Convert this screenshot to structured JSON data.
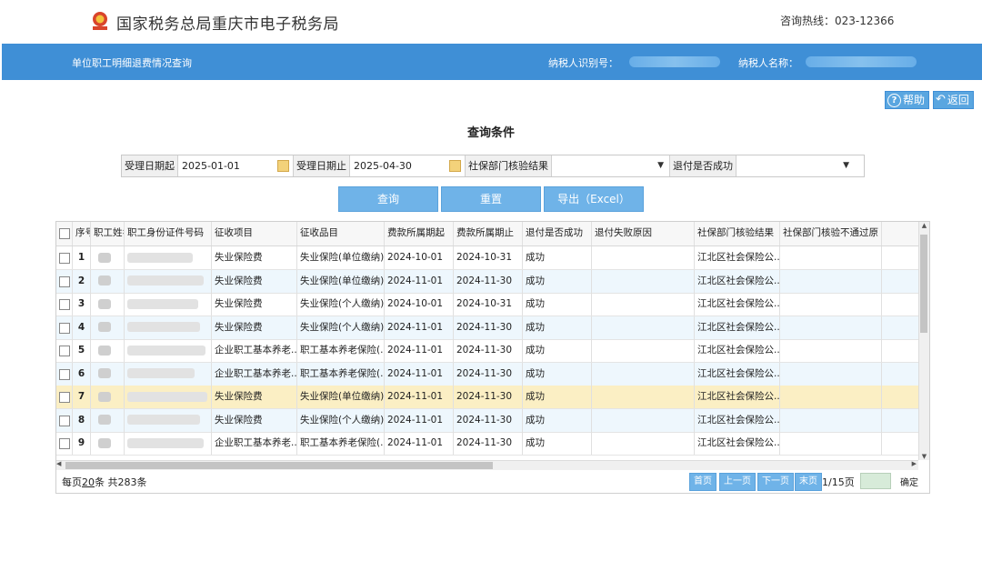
{
  "header": {
    "site_title": "国家税务总局重庆市电子税务局",
    "hotline": "咨询热线：023-12366",
    "emblem_icon": "tax-emblem-icon"
  },
  "banner": {
    "page_name": "单位职工明细退费情况查询",
    "taxpayer_id_label": "纳税人识别号：",
    "taxpayer_name_label": "纳税人名称："
  },
  "toolbar": {
    "help_label": "帮助",
    "back_label": "返回"
  },
  "query": {
    "title": "查询条件",
    "start_label": "受理日期起",
    "start_value": "2025-01-01",
    "end_label": "受理日期止",
    "end_value": "2025-04-30",
    "check_label": "社保部门核验结果",
    "check_value": "",
    "success_label": "退付是否成功",
    "success_value": "",
    "search_btn": "查询",
    "reset_btn": "重置",
    "export_btn": "导出（Excel）"
  },
  "table": {
    "columns": [
      "序号",
      "职工姓名",
      "职工身份证件号码",
      "征收项目",
      "征收品目",
      "费款所属期起",
      "费款所属期止",
      "退付是否成功",
      "退付失败原因",
      "社保部门核验结果",
      "社保部门核验不通过原"
    ],
    "rows": [
      {
        "no": "1",
        "item": "失业保险费",
        "sub": "失业保险(单位缴纳)",
        "start": "2024-10-01",
        "end": "2024-10-31",
        "ok": "成功",
        "reason": "",
        "check": "江北区社会保险公..."
      },
      {
        "no": "2",
        "item": "失业保险费",
        "sub": "失业保险(单位缴纳)",
        "start": "2024-11-01",
        "end": "2024-11-30",
        "ok": "成功",
        "reason": "",
        "check": "江北区社会保险公..."
      },
      {
        "no": "3",
        "item": "失业保险费",
        "sub": "失业保险(个人缴纳)",
        "start": "2024-10-01",
        "end": "2024-10-31",
        "ok": "成功",
        "reason": "",
        "check": "江北区社会保险公..."
      },
      {
        "no": "4",
        "item": "失业保险费",
        "sub": "失业保险(个人缴纳)",
        "start": "2024-11-01",
        "end": "2024-11-30",
        "ok": "成功",
        "reason": "",
        "check": "江北区社会保险公..."
      },
      {
        "no": "5",
        "item": "企业职工基本养老...",
        "sub": "职工基本养老保险(...",
        "start": "2024-11-01",
        "end": "2024-11-30",
        "ok": "成功",
        "reason": "",
        "check": "江北区社会保险公..."
      },
      {
        "no": "6",
        "item": "企业职工基本养老...",
        "sub": "职工基本养老保险(...",
        "start": "2024-11-01",
        "end": "2024-11-30",
        "ok": "成功",
        "reason": "",
        "check": "江北区社会保险公..."
      },
      {
        "no": "7",
        "item": "失业保险费",
        "sub": "失业保险(单位缴纳)",
        "start": "2024-11-01",
        "end": "2024-11-30",
        "ok": "成功",
        "reason": "",
        "check": "江北区社会保险公..."
      },
      {
        "no": "8",
        "item": "失业保险费",
        "sub": "失业保险(个人缴纳)",
        "start": "2024-11-01",
        "end": "2024-11-30",
        "ok": "成功",
        "reason": "",
        "check": "江北区社会保险公..."
      },
      {
        "no": "9",
        "item": "企业职工基本养老...",
        "sub": "职工基本养老保险(...",
        "start": "2024-11-01",
        "end": "2024-11-30",
        "ok": "成功",
        "reason": "",
        "check": "江北区社会保险公..."
      }
    ]
  },
  "pager": {
    "per_page_prefix": "每页",
    "per_page": "20",
    "per_page_suffix": "条 共283条",
    "first": "首页",
    "prev": "上一页",
    "next": "下一页",
    "last": "末页",
    "page_info": "1/15页",
    "confirm": "确定"
  },
  "colors": {
    "accent": "#3f8fd6",
    "selected_row": "#fbefc4",
    "alt_row": "#eef7fd"
  }
}
